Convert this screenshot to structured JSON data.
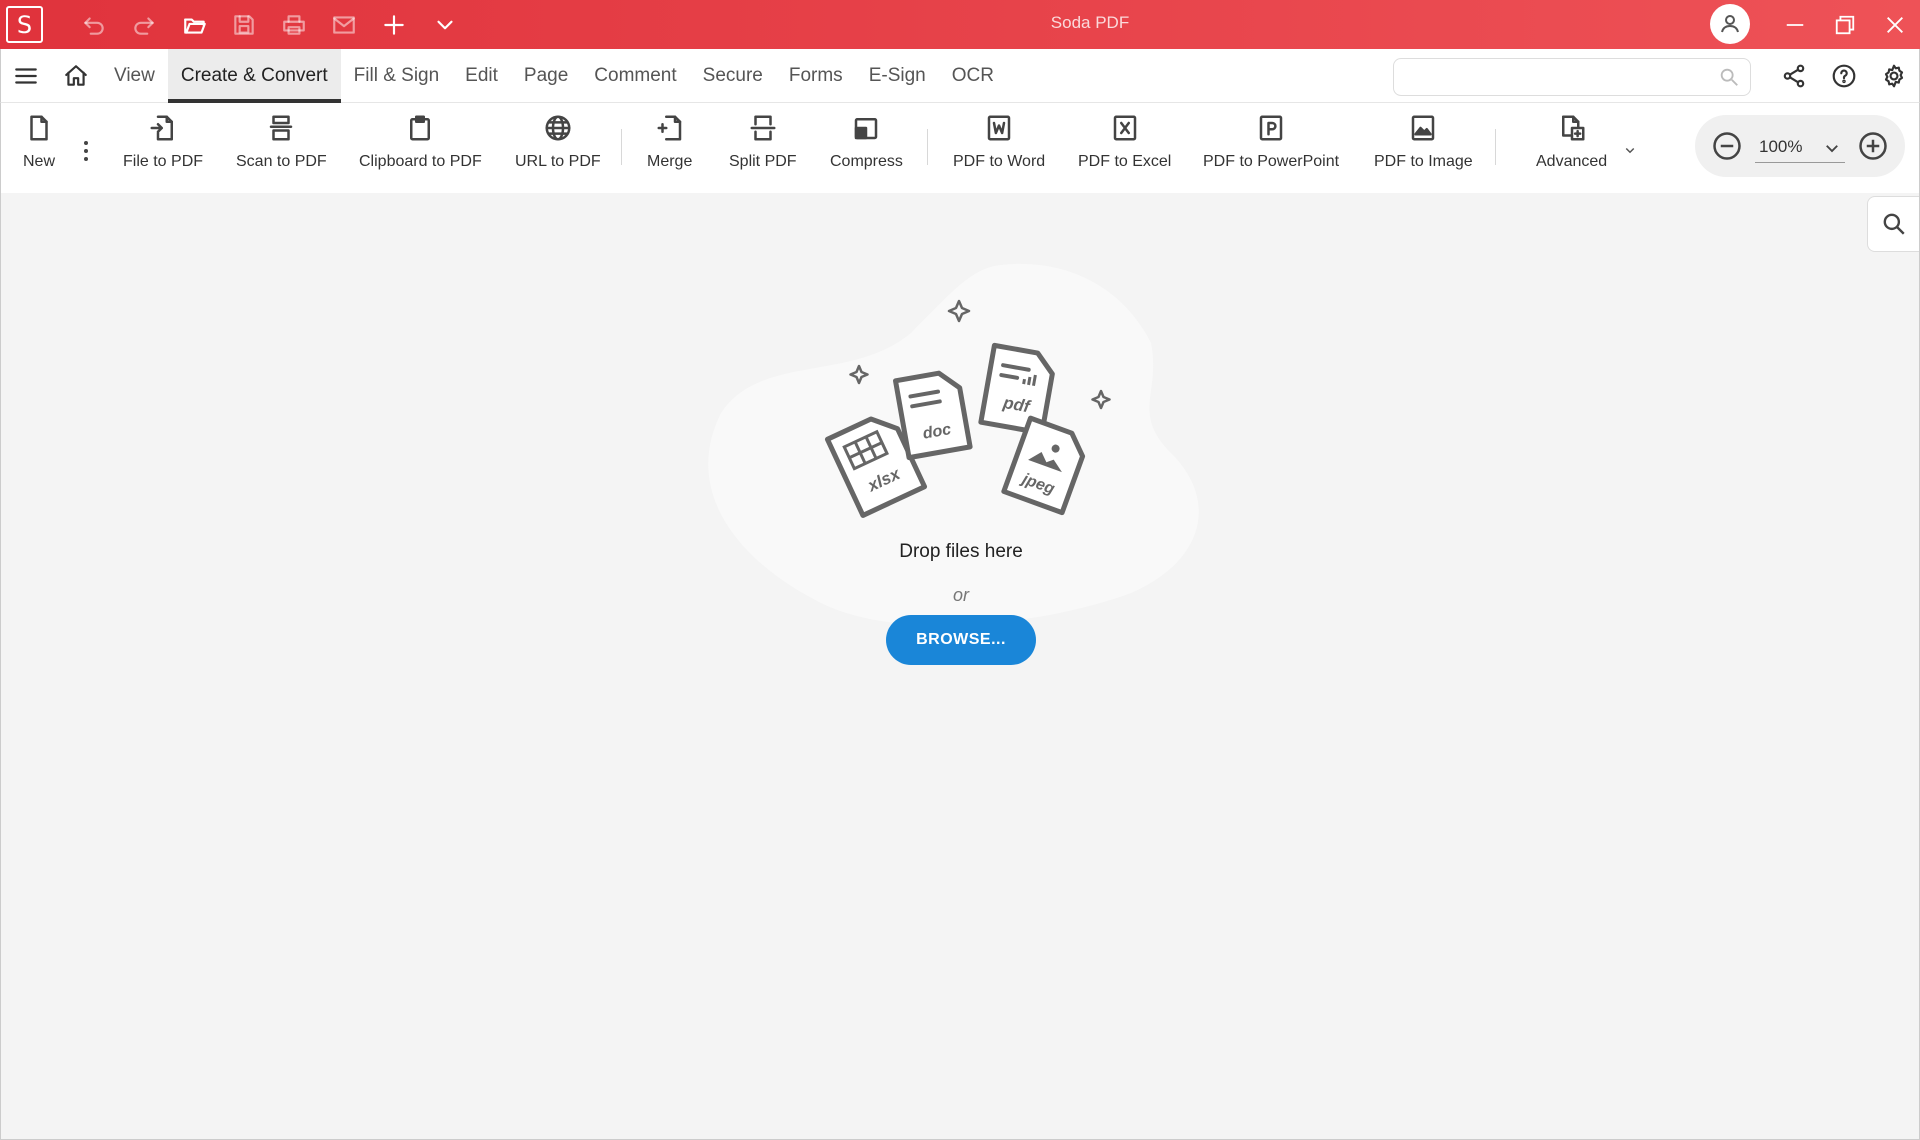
{
  "app": {
    "title": "Soda PDF",
    "logo_letter": "S"
  },
  "quick_access": {
    "icons": [
      "undo-icon",
      "redo-icon",
      "open-folder-icon",
      "save-icon",
      "print-icon",
      "mail-icon",
      "plus-icon",
      "chevron-down-icon"
    ]
  },
  "menu": {
    "tabs": [
      {
        "label": "View",
        "active": false
      },
      {
        "label": "Create & Convert",
        "active": true
      },
      {
        "label": "Fill & Sign",
        "active": false
      },
      {
        "label": "Edit",
        "active": false
      },
      {
        "label": "Page",
        "active": false
      },
      {
        "label": "Comment",
        "active": false
      },
      {
        "label": "Secure",
        "active": false
      },
      {
        "label": "Forms",
        "active": false
      },
      {
        "label": "E-Sign",
        "active": false
      },
      {
        "label": "OCR",
        "active": false
      }
    ],
    "search": {
      "value": "",
      "placeholder": ""
    }
  },
  "ribbon": {
    "new_label": "New",
    "file_to_pdf": "File to PDF",
    "scan_to_pdf": "Scan to PDF",
    "clipboard_to_pdf": "Clipboard to PDF",
    "url_to_pdf": "URL to PDF",
    "merge": "Merge",
    "split_pdf": "Split PDF",
    "compress": "Compress",
    "pdf_to_word": "PDF to Word",
    "pdf_to_excel": "PDF to Excel",
    "pdf_to_powerpoint": "PDF to PowerPoint",
    "pdf_to_image": "PDF to Image",
    "advanced": "Advanced"
  },
  "zoom": {
    "value": "100%"
  },
  "drop": {
    "file_types": [
      "xlsx",
      "doc",
      "pdf",
      "jpeg"
    ],
    "drop_text": "Drop files here",
    "or_text": "or",
    "browse_label": "BROWSE..."
  },
  "colors": {
    "titlebar": "#e0333c",
    "accent_button": "#1a86d8"
  }
}
